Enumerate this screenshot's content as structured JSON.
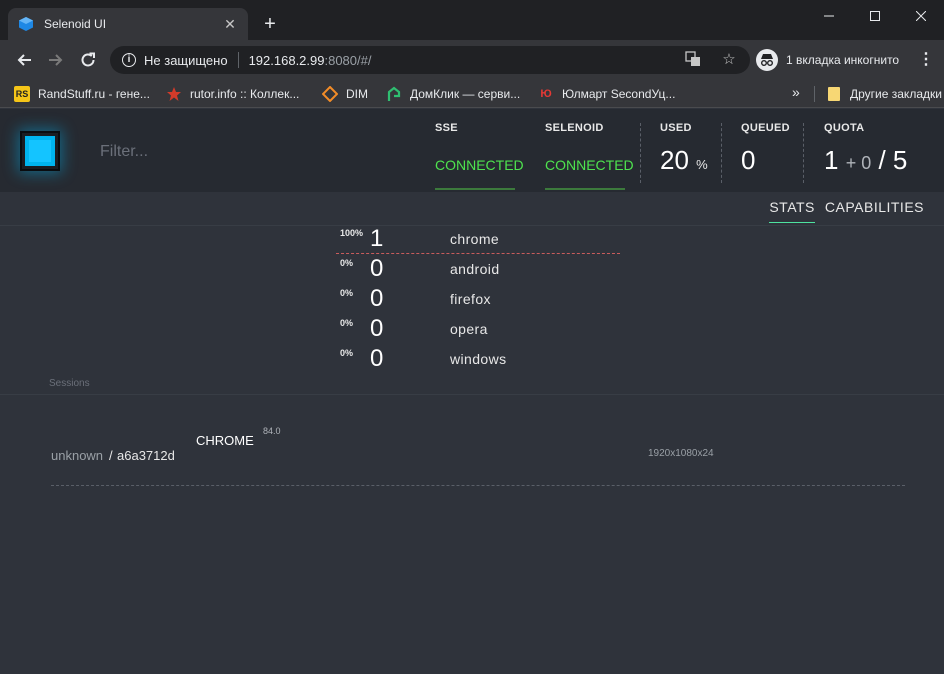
{
  "browser": {
    "tab_title": "Selenoid UI",
    "insecure_label": "Не защищено",
    "url_host": "192.168.2.99",
    "url_rest": ":8080/#/",
    "incognito_label": "1 вкладка инкогнито",
    "bookmarks": [
      {
        "label": "RandStuff.ru - гене...",
        "icon": "randstuff-icon",
        "color": "#f5c518"
      },
      {
        "label": "rutor.info :: Коллек...",
        "icon": "rutor-icon",
        "color": "#d23b2a"
      },
      {
        "label": "DIM",
        "icon": "dim-icon",
        "color": "#f28c28"
      },
      {
        "label": "ДомКлик — серви...",
        "icon": "domclick-icon",
        "color": "#2fbf71"
      },
      {
        "label": "Юлмарт SecondУц...",
        "icon": "ulmart-icon",
        "color": "#e53935"
      }
    ],
    "other_bookmarks": "Другие закладки"
  },
  "header": {
    "filter_placeholder": "Filter...",
    "sse": {
      "label": "SSE",
      "status": "CONNECTED"
    },
    "selenoid": {
      "label": "SELENOID",
      "status": "CONNECTED"
    },
    "used": {
      "label": "USED",
      "value": "20",
      "unit": "%"
    },
    "queued": {
      "label": "QUEUED",
      "value": "0"
    },
    "quota": {
      "label": "QUOTA",
      "used": "1",
      "pending": "+ 0",
      "total": "/ 5"
    }
  },
  "view_tabs": {
    "stats": "STATS",
    "capabilities": "CAPABILITIES"
  },
  "browsers": [
    {
      "percent": "100%",
      "count": "1",
      "name": "chrome"
    },
    {
      "percent": "0%",
      "count": "0",
      "name": "android"
    },
    {
      "percent": "0%",
      "count": "0",
      "name": "firefox"
    },
    {
      "percent": "0%",
      "count": "0",
      "name": "opera"
    },
    {
      "percent": "0%",
      "count": "0",
      "name": "windows"
    }
  ],
  "sessions_label": "Sessions",
  "sessions": [
    {
      "user": "unknown",
      "slash": "/",
      "id": "a6a3712d",
      "browser": "CHROME",
      "version": "84.0",
      "resolution": "1920x1080x24"
    }
  ],
  "colors": {
    "accent": "#00b4ef",
    "connected": "#4ee34e",
    "background": "#2f333b",
    "header": "#262a31"
  }
}
